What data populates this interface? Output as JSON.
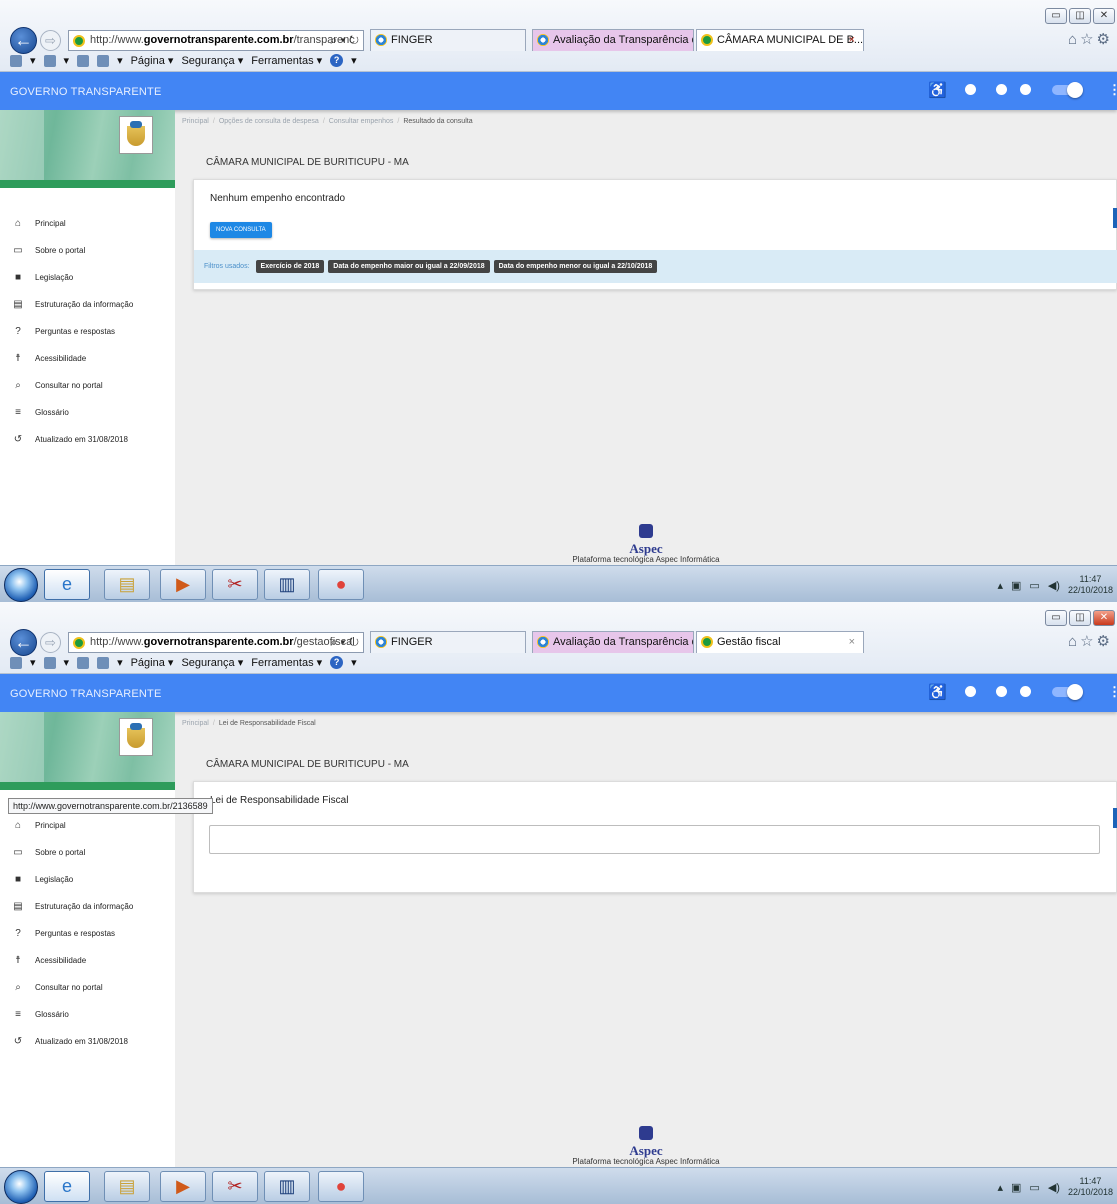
{
  "top": {
    "browser": {
      "address_prefix": "http://www.",
      "address_domain": "governotransparente.com.br",
      "address_path": "/transparenc",
      "tabs": [
        {
          "label": "FINGER"
        },
        {
          "label": "Avaliação da Transparência do..."
        },
        {
          "label": "CÂMARA MUNICIPAL DE B..."
        }
      ],
      "active_tab_close": "×"
    },
    "breadcrumb": [
      "Principal",
      "Opções de consulta de despesa",
      "Consultar empenhos",
      "Resultado da consulta"
    ],
    "org_title": "CÂMARA MUNICIPAL DE BURITICUPU - MA",
    "card_title": "Nenhum empenho encontrado",
    "button_label": "NOVA CONSULTA",
    "filters_label": "Filtros usados:",
    "filters": [
      "Exercício de 2018",
      "Data do empenho maior ou igual a 22/09/2018",
      "Data do empenho menor ou igual a 22/10/2018"
    ],
    "clock_time": "11:47",
    "clock_date": "22/10/2018"
  },
  "bottom": {
    "browser": {
      "address_prefix": "http://www.",
      "address_domain": "governotransparente.com.br",
      "address_path": "/gestaofiscal",
      "tabs": [
        {
          "label": "FINGER"
        },
        {
          "label": "Avaliação da Transparência do..."
        },
        {
          "label": "Gestão fiscal"
        }
      ],
      "active_tab_close": "×"
    },
    "breadcrumb": [
      "Principal",
      "Lei de Responsabilidade Fiscal"
    ],
    "org_title": "CÂMARA MUNICIPAL DE BURITICUPU - MA",
    "card_title": "Lei de Responsabilidade Fiscal",
    "status_url": "http://www.governotransparente.com.br/2136589",
    "clock_time": "11:47",
    "clock_date": "22/10/2018"
  },
  "command_bar": {
    "page": "Página ▾",
    "security": "Segurança ▾",
    "tools": "Ferramentas ▾"
  },
  "app": {
    "title": "GOVERNO TRANSPARENTE"
  },
  "sidebar": {
    "items": [
      {
        "label": "Principal",
        "icon": "home-icon"
      },
      {
        "label": "Sobre o portal",
        "icon": "folder-icon"
      },
      {
        "label": "Legislação",
        "icon": "document-icon"
      },
      {
        "label": "Estruturação da informação",
        "icon": "structure-icon"
      },
      {
        "label": "Perguntas e respostas",
        "icon": "question-icon"
      },
      {
        "label": "Acessibilidade",
        "icon": "accessibility-icon"
      },
      {
        "label": "Consultar no portal",
        "icon": "search-icon"
      },
      {
        "label": "Glossário",
        "icon": "list-icon"
      },
      {
        "label": "Atualizado em 31/08/2018",
        "icon": "history-icon"
      }
    ]
  },
  "footer": {
    "brand": "Aspec",
    "platform": "Plataforma tecnológica Aspec Informática"
  }
}
